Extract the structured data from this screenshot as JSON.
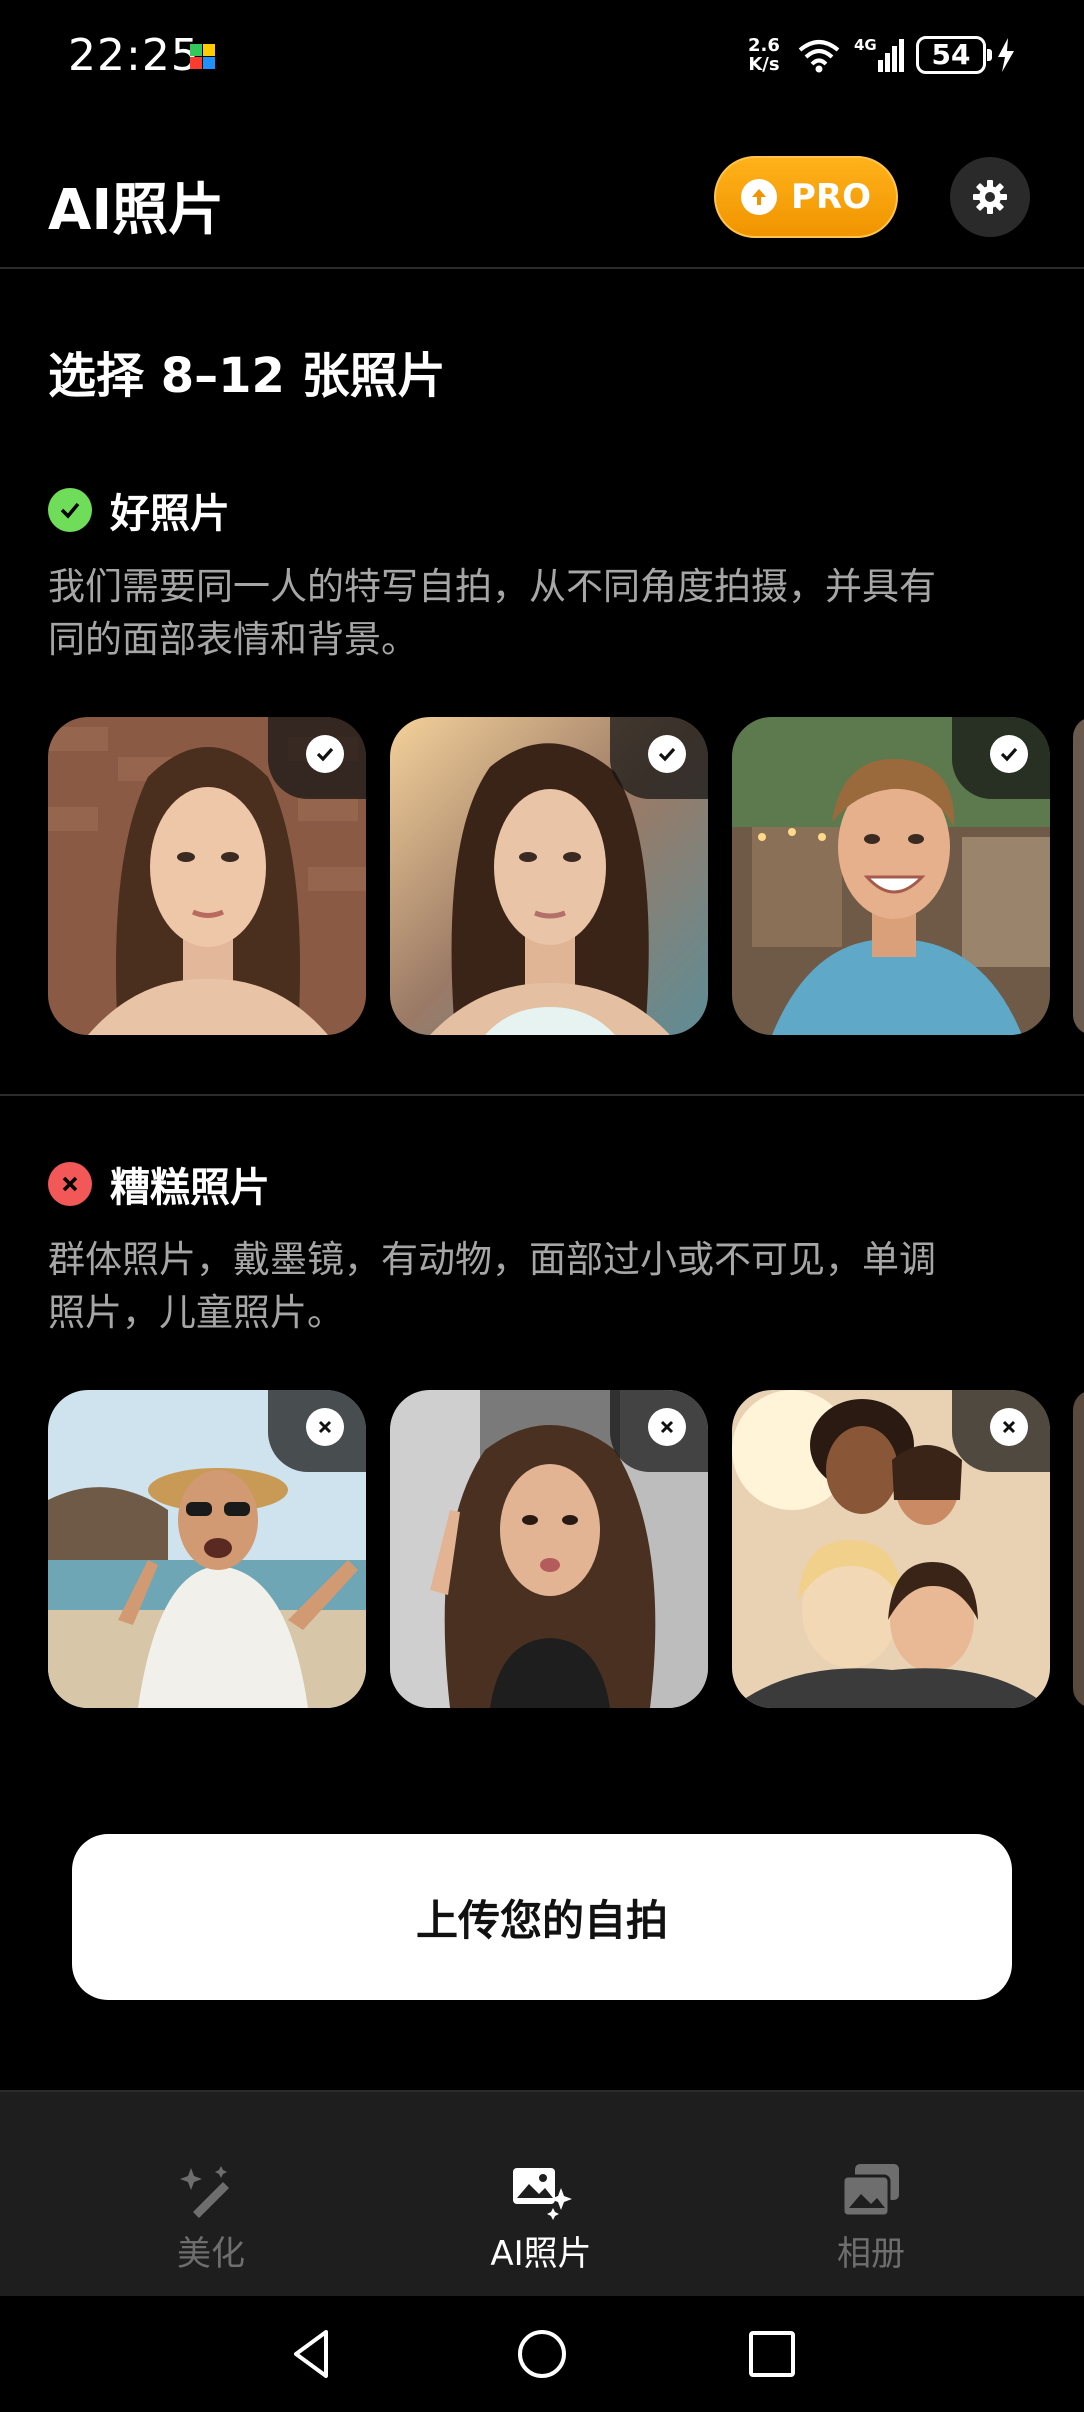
{
  "status_bar": {
    "time": "22:25",
    "speed_value": "2.6",
    "speed_unit": "K/s",
    "network": "4G",
    "battery": "54"
  },
  "header": {
    "title": "AI照片",
    "pro_label": "PRO",
    "accent_color": "#f5a300"
  },
  "intro": {
    "title": "选择 8–12 张照片"
  },
  "good": {
    "label": "好照片",
    "desc_line1": "我们需要同一人的特写自拍，从不同角度拍摄，并具有",
    "desc_line2": "同的面部表情和背景。",
    "status_color": "#6fdc5a"
  },
  "bad": {
    "label": "糟糕照片",
    "desc_line1": "群体照片，戴墨镜，有动物，面部过小或不可见，单调",
    "desc_line2": "照片，儿童照片。",
    "status_color": "#f25858"
  },
  "upload": {
    "label": "上传您的自拍"
  },
  "bottom_nav": {
    "items": [
      {
        "label": "美化",
        "icon": "magic-wand-icon",
        "active": false
      },
      {
        "label": "AI照片",
        "icon": "ai-photo-sparkle-icon",
        "active": true
      },
      {
        "label": "相册",
        "icon": "album-icon",
        "active": false
      }
    ]
  }
}
